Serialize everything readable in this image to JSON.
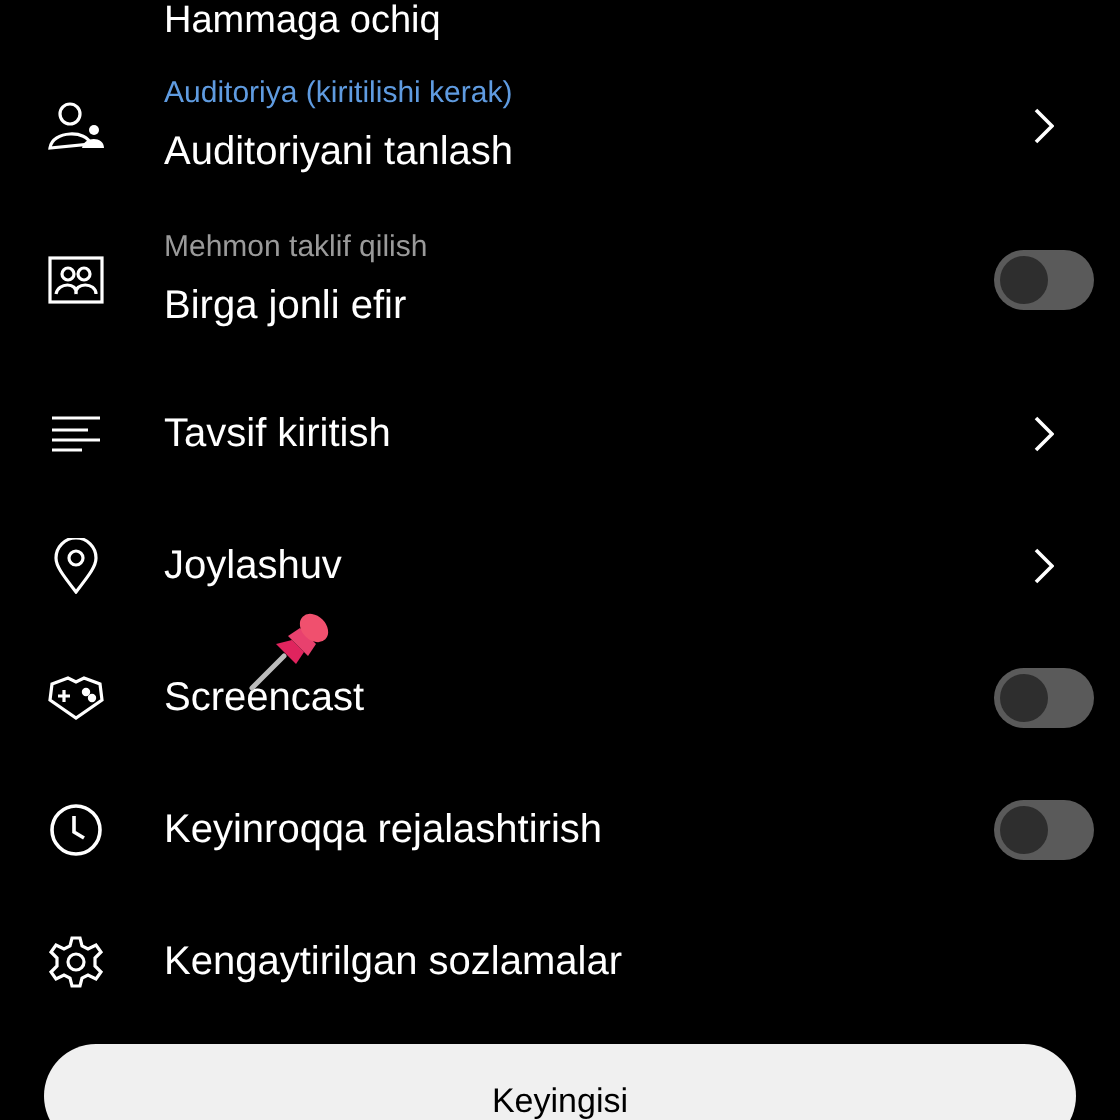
{
  "top_value": "Hammaga ochiq",
  "items": [
    {
      "kind": "chevron",
      "subtitle": {
        "text": "Auditoriya (kiritilishi kerak)",
        "kind": "required"
      },
      "title": "Auditoriyani tanlash"
    },
    {
      "kind": "toggle",
      "subtitle": {
        "text": "Mehmon taklif qilish",
        "kind": "hint"
      },
      "title": "Birga jonli efir",
      "on": false
    },
    {
      "kind": "chevron",
      "title": "Tavsif kiritish"
    },
    {
      "kind": "chevron",
      "title": "Joylashuv"
    },
    {
      "kind": "toggle",
      "title": "Screencast",
      "on": false
    },
    {
      "kind": "toggle",
      "title": "Keyinroqqa rejalashtirish",
      "on": false
    },
    {
      "kind": "plain",
      "title": "Kengaytirilgan sozlamalar"
    }
  ],
  "next_button": "Keyingisi"
}
